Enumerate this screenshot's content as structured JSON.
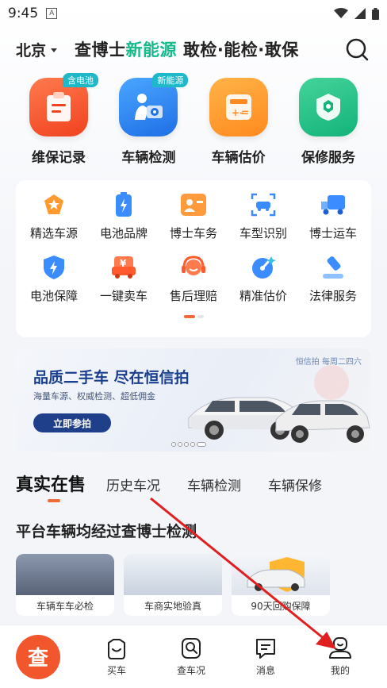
{
  "status": {
    "time": "9:45"
  },
  "header": {
    "city": "北京",
    "slogan_a": "查博士",
    "slogan_hl": "新能源",
    "slogan_b": " 敢检·能检·敢保"
  },
  "big_services": [
    {
      "label": "维保记录",
      "badge": "含电池"
    },
    {
      "label": "车辆检测",
      "badge": "新能源"
    },
    {
      "label": "车辆估价",
      "badge": ""
    },
    {
      "label": "保修服务",
      "badge": ""
    }
  ],
  "grid_row1": [
    "精选车源",
    "电池品牌",
    "博士车务",
    "车型识别",
    "博士运车"
  ],
  "grid_row2": [
    "电池保障",
    "一键卖车",
    "售后理赔",
    "精准估价",
    "法律服务"
  ],
  "banner": {
    "tag": "恒信拍 每周二四六",
    "title": "品质二手车 尽在恒信拍",
    "sub": "海量车源、权威检测、超低佣金",
    "cta": "立即参拍"
  },
  "tabs": [
    "真实在售",
    "历史车况",
    "车辆检测",
    "车辆保修"
  ],
  "section_title": "平台车辆均经过查博士检测",
  "promo_cards": [
    "车辆车车必检",
    "车商实地验真",
    "90天回购保障"
  ],
  "nav": {
    "main": "查",
    "items": [
      "买车",
      "查车况",
      "消息",
      "我的"
    ]
  },
  "colors": {
    "accent": "#f2562d",
    "green": "#14b98c",
    "blue_dark": "#1f3f8a"
  }
}
